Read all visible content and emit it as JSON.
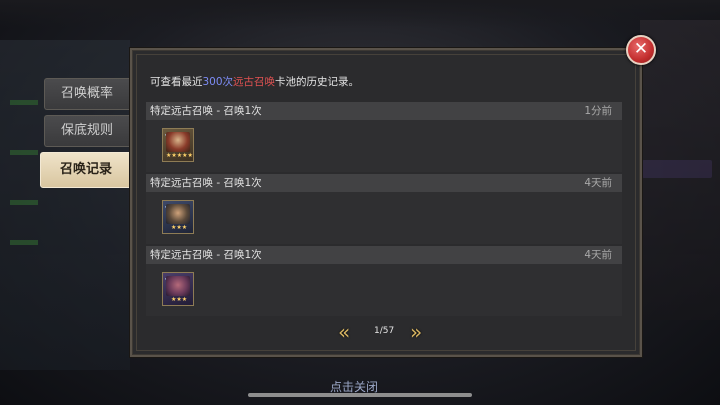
{
  "window": {
    "close_icon": "close-icon"
  },
  "tabs": [
    {
      "label": "召唤概率",
      "active": false
    },
    {
      "label": "保底规则",
      "active": false
    },
    {
      "label": "召唤记录",
      "active": true
    }
  ],
  "intro": {
    "prefix": "可查看最近",
    "count": "300次",
    "pool": "远古召唤",
    "suffix": "卡池的历史记录。"
  },
  "records": [
    {
      "title": "特定远古召唤 - 召唤1次",
      "time": "1分前"
    },
    {
      "title": "特定远古召唤 - 召唤1次",
      "time": "4天前"
    },
    {
      "title": "特定远古召唤 - 召唤1次",
      "time": "4天前"
    }
  ],
  "pagination": {
    "page": "1/57",
    "prev_icon": "double-chevron-left-icon",
    "next_icon": "double-chevron-right-icon"
  },
  "footer": {
    "tap_close": "点击关闭"
  },
  "colors": {
    "accent_count": "#7d8cf5",
    "accent_pool": "#e05252",
    "arrow": "#d9b662",
    "close": "#c32e2e"
  }
}
